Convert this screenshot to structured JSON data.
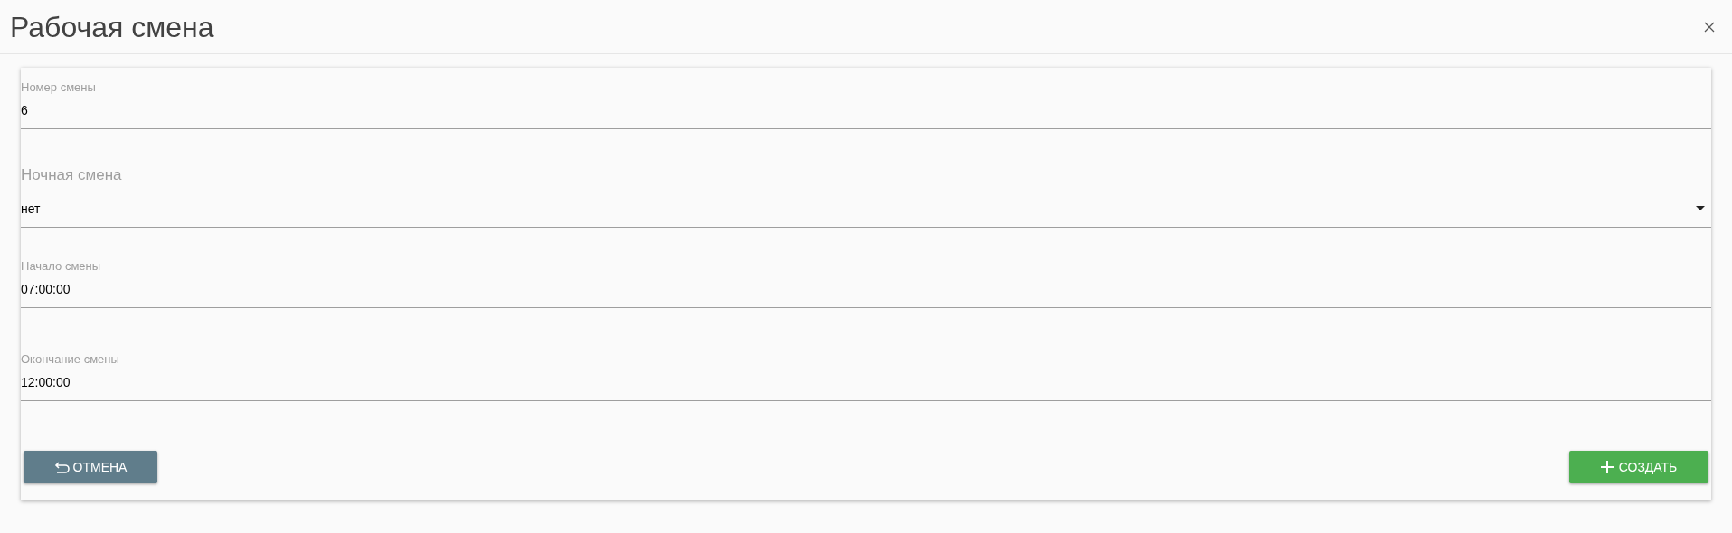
{
  "dialog": {
    "title": "Рабочая смена"
  },
  "fields": [
    {
      "kind": "text",
      "label": "Номер смены",
      "value": "6"
    },
    {
      "kind": "select",
      "label": "Ночная смена",
      "value": "нет"
    },
    {
      "kind": "text",
      "label": "Начало смены",
      "value": "07:00:00"
    },
    {
      "kind": "text",
      "label": "Окончание смены",
      "value": "12:00:00"
    }
  ],
  "buttons": [
    {
      "kind": "cancel",
      "label": "ОТМЕНА"
    },
    {
      "kind": "create",
      "label": "СОЗДАТЬ"
    }
  ]
}
